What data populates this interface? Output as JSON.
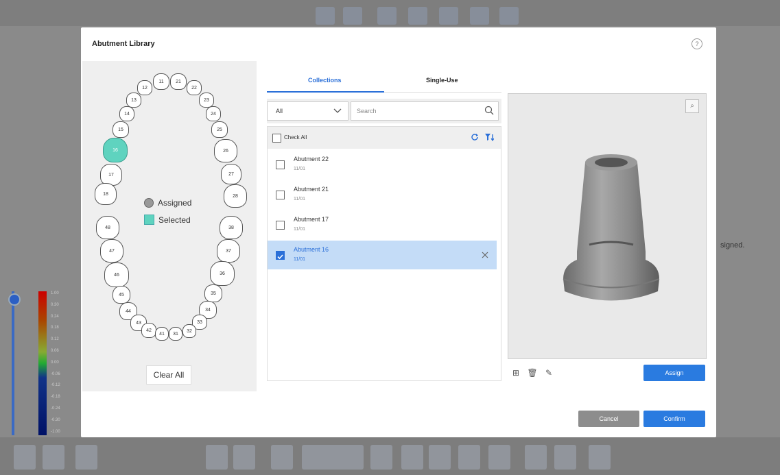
{
  "dialog": {
    "title": "Abutment Library",
    "help_icon": "?"
  },
  "tooth_chart": {
    "teeth": [
      {
        "id": "11"
      },
      {
        "id": "21"
      },
      {
        "id": "12"
      },
      {
        "id": "22"
      },
      {
        "id": "13"
      },
      {
        "id": "23"
      },
      {
        "id": "14"
      },
      {
        "id": "24"
      },
      {
        "id": "15"
      },
      {
        "id": "25"
      },
      {
        "id": "16",
        "selected": true
      },
      {
        "id": "26"
      },
      {
        "id": "17"
      },
      {
        "id": "27"
      },
      {
        "id": "18"
      },
      {
        "id": "28"
      },
      {
        "id": "48"
      },
      {
        "id": "38"
      },
      {
        "id": "47"
      },
      {
        "id": "37"
      },
      {
        "id": "46"
      },
      {
        "id": "36"
      },
      {
        "id": "45"
      },
      {
        "id": "35"
      },
      {
        "id": "44"
      },
      {
        "id": "34"
      },
      {
        "id": "43"
      },
      {
        "id": "33"
      },
      {
        "id": "42"
      },
      {
        "id": "32"
      },
      {
        "id": "41"
      },
      {
        "id": "31"
      }
    ],
    "legend_assigned": "Assigned",
    "legend_selected": "Selected",
    "clear_all": "Clear All"
  },
  "tabs": [
    {
      "label": "Collections",
      "active": true
    },
    {
      "label": "Single-Use",
      "active": false
    }
  ],
  "filter": {
    "selected": "All",
    "search_placeholder": "Search"
  },
  "list": {
    "check_all": "Check All",
    "items": [
      {
        "name": "Abutment 22",
        "sub": "11/01",
        "checked": false
      },
      {
        "name": "Abutment 21",
        "sub": "11/01",
        "checked": false
      },
      {
        "name": "Abutment 17",
        "sub": "11/01",
        "checked": false
      },
      {
        "name": "Abutment 16",
        "sub": "11/01",
        "checked": true
      }
    ]
  },
  "preview": {
    "view_icon": "view-icon"
  },
  "buttons": {
    "assign": "Assign",
    "cancel": "Cancel",
    "confirm": "Confirm"
  },
  "background": {
    "legend_values": [
      "1.00",
      "0.30",
      "0.24",
      "0.18",
      "0.12",
      "0.06",
      "0.00",
      "-0.06",
      "-0.12",
      "-0.18",
      "-0.24",
      "-0.30",
      "-1.00"
    ],
    "side_text": "signed."
  },
  "colors": {
    "accent": "#2a7be0",
    "selected_tooth": "#5fd3bf",
    "selected_row": "#c4dcf7"
  }
}
